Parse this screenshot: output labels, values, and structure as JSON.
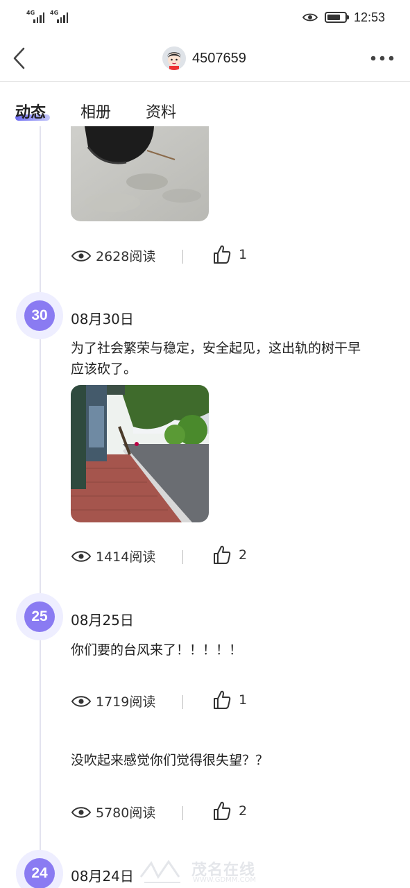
{
  "status_bar": {
    "signal1_label": "4G",
    "signal2_label": "4G",
    "time": "12:53"
  },
  "header": {
    "title": "4507659",
    "back_icon": "chevron-left-icon",
    "more_icon": "more-dots-icon"
  },
  "tabs": [
    {
      "label": "动态",
      "active": true
    },
    {
      "label": "相册",
      "active": false
    },
    {
      "label": "资料",
      "active": false
    }
  ],
  "posts": [
    {
      "partial": true,
      "views": "2628阅读",
      "likes": "1"
    },
    {
      "day": "30",
      "date": "08月30日",
      "text": "为了社会繁荣与稳定，安全起见，这出轨的树干早应该砍了。",
      "views": "1414阅读",
      "likes": "2"
    },
    {
      "day": "25",
      "date": "08月25日",
      "text": "你们要的台风来了！！！！！",
      "views": "1719阅读",
      "likes": "1"
    },
    {
      "text": "没吹起来感觉你们觉得很失望？？",
      "views": "5780阅读",
      "likes": "2"
    },
    {
      "day": "24",
      "date": "08月24日"
    }
  ],
  "watermark": {
    "text": "茂名在线",
    "url": "WWW.GDMM.COM"
  },
  "colors": {
    "accent": "#8a7bf2",
    "accent_light": "#eeeeff",
    "timeline": "#e3e3ef"
  }
}
